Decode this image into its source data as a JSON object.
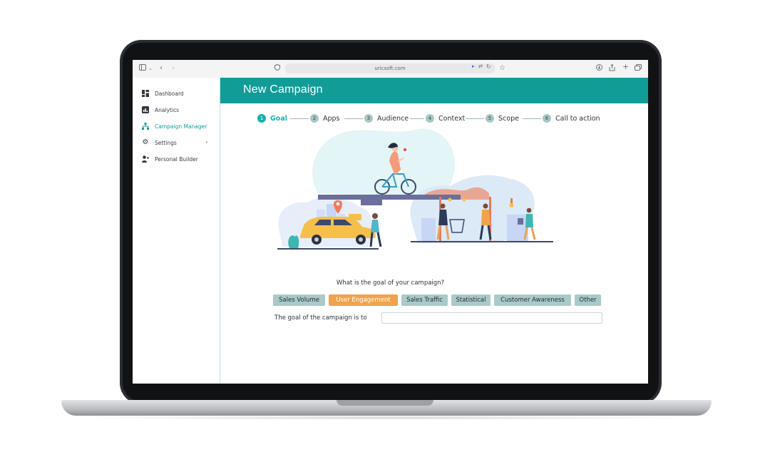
{
  "browser": {
    "url": "uricsoft.com",
    "icons": [
      "sidebar-toggle-icon",
      "chevron-down-icon",
      "back-icon",
      "forward-icon",
      "shield-icon",
      "speaker-icon",
      "translate-icon",
      "reload-icon",
      "star-icon",
      "download-icon",
      "share-icon",
      "new-tab-icon",
      "tabs-icon"
    ]
  },
  "sidebar": {
    "items": [
      {
        "label": "Dashboard",
        "icon": "dashboard-icon"
      },
      {
        "label": "Analytics",
        "icon": "analytics-icon"
      },
      {
        "label": "Campaign Manager",
        "icon": "hierarchy-icon",
        "active": true
      },
      {
        "label": "Settings",
        "icon": "gear-icon",
        "has_submenu": true
      },
      {
        "label": "Personal Builder",
        "icon": "add-user-icon"
      }
    ]
  },
  "header": {
    "title": "New Campaign"
  },
  "steps": [
    {
      "num": "1",
      "label": "Goal",
      "active": true
    },
    {
      "num": "2",
      "label": "Apps"
    },
    {
      "num": "3",
      "label": "Audience"
    },
    {
      "num": "4",
      "label": "Context"
    },
    {
      "num": "5",
      "label": "Scope"
    },
    {
      "num": "6",
      "label": "Call to action"
    }
  ],
  "form": {
    "question": "What is the goal of your campaign?",
    "options": [
      "Sales Volume",
      "User Engagement",
      "Sales Traffic",
      "Statistical",
      "Customer Awareness",
      "Other"
    ],
    "selected_option": "User Engagement",
    "goal_label": "The goal of the campaign is to",
    "goal_value": ""
  },
  "colors": {
    "accent": "#119c98",
    "selected": "#f0a34c",
    "option_bg": "#a9cac8"
  }
}
